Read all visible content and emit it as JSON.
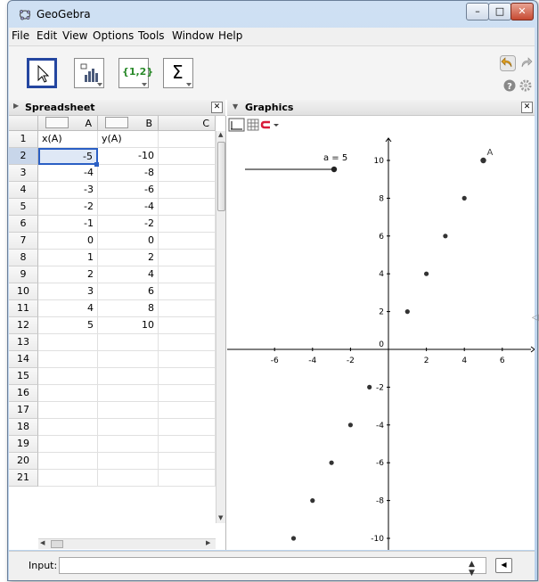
{
  "window": {
    "title": "GeoGebra",
    "minimize": "–",
    "maximize": "□",
    "close": "✕"
  },
  "menu": [
    "File",
    "Edit",
    "View",
    "Options",
    "Tools",
    "Window",
    "Help"
  ],
  "toolbar": {
    "list_tool_label": "{1,2}",
    "sum_tool_label": "Σ"
  },
  "spreadsheet": {
    "title": "Spreadsheet",
    "close_label": "✕",
    "columns": [
      "A",
      "B",
      "C"
    ],
    "rows": [
      "1",
      "2",
      "3",
      "4",
      "5",
      "6",
      "7",
      "8",
      "9",
      "10",
      "11",
      "12",
      "13",
      "14",
      "15",
      "16",
      "17",
      "18",
      "19",
      "20",
      "21"
    ],
    "header_row": [
      "x(A)",
      "y(A)"
    ],
    "data": [
      [
        "-5",
        "-10"
      ],
      [
        "-4",
        "-8"
      ],
      [
        "-3",
        "-6"
      ],
      [
        "-2",
        "-4"
      ],
      [
        "-1",
        "-2"
      ],
      [
        "0",
        "0"
      ],
      [
        "1",
        "2"
      ],
      [
        "2",
        "4"
      ],
      [
        "3",
        "6"
      ],
      [
        "4",
        "8"
      ],
      [
        "5",
        "10"
      ]
    ],
    "selected_cell": "A2"
  },
  "graphics": {
    "title": "Graphics",
    "close_label": "✕",
    "slider_label": "a = 5",
    "point_label": "A",
    "origin_label": "0",
    "x_ticks": [
      "-6",
      "-4",
      "-2",
      "2",
      "4",
      "6"
    ],
    "y_ticks": [
      "10",
      "8",
      "6",
      "4",
      "2",
      "-2",
      "-4",
      "-6",
      "-8",
      "-10"
    ],
    "points": [
      {
        "x": -5,
        "y": -10
      },
      {
        "x": -4,
        "y": -8
      },
      {
        "x": -3,
        "y": -6
      },
      {
        "x": -2,
        "y": -4
      },
      {
        "x": -1,
        "y": -2
      },
      {
        "x": 1,
        "y": 2
      },
      {
        "x": 2,
        "y": 4
      },
      {
        "x": 3,
        "y": 6
      },
      {
        "x": 4,
        "y": 8
      },
      {
        "x": 5,
        "y": 10
      }
    ]
  },
  "input": {
    "label": "Input:",
    "value": ""
  }
}
